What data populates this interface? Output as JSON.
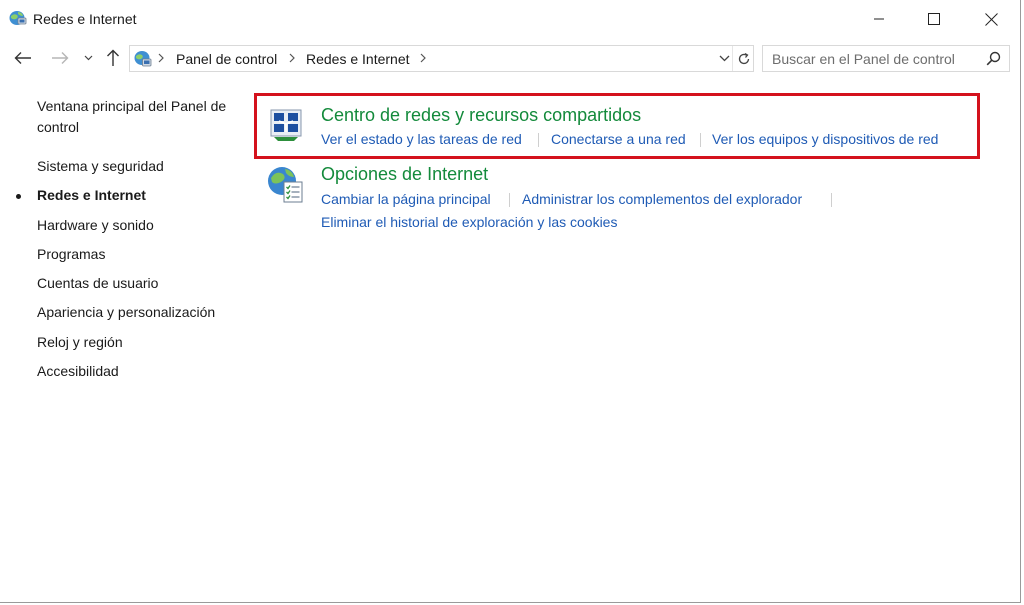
{
  "window": {
    "title": "Redes e Internet"
  },
  "address": {
    "crumbs": [
      "Panel de control",
      "Redes e Internet"
    ],
    "search_placeholder": "Buscar en el Panel de control"
  },
  "sidebar": {
    "home_label": "Ventana principal del Panel de control",
    "items": [
      {
        "label": "Sistema y seguridad",
        "current": false
      },
      {
        "label": "Redes e Internet",
        "current": true
      },
      {
        "label": "Hardware y sonido",
        "current": false
      },
      {
        "label": "Programas",
        "current": false
      },
      {
        "label": "Cuentas de usuario",
        "current": false
      },
      {
        "label": "Apariencia y personalización",
        "current": false
      },
      {
        "label": "Reloj y región",
        "current": false
      },
      {
        "label": "Accesibilidad",
        "current": false
      }
    ]
  },
  "categories": [
    {
      "title": "Centro de redes y recursos compartidos",
      "icon": "network-center-icon",
      "links": [
        "Ver el estado y las tareas de red",
        "Conectarse a una red",
        "Ver los equipos y dispositivos de red"
      ]
    },
    {
      "title": "Opciones de Internet",
      "icon": "internet-options-icon",
      "links": [
        "Cambiar la página principal",
        "Administrar los complementos del explorador",
        "Eliminar el historial de exploración y las cookies"
      ]
    }
  ],
  "colors": {
    "category_title": "#138a3b",
    "link": "#1f5bb5",
    "highlight_border": "#d4121d"
  }
}
